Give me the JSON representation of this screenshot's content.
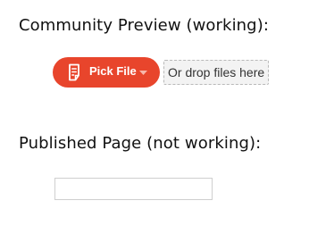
{
  "community_section": {
    "heading": "Community Preview (working):",
    "pick_button": {
      "label": "Pick File",
      "icon": "file-icon",
      "caret_icon": "chevron-down-icon",
      "color": "#e8452c"
    },
    "drop_zone": {
      "label": "Or drop files here"
    }
  },
  "published_section": {
    "heading": "Published Page (not working):",
    "widget": {
      "state": "empty"
    }
  }
}
